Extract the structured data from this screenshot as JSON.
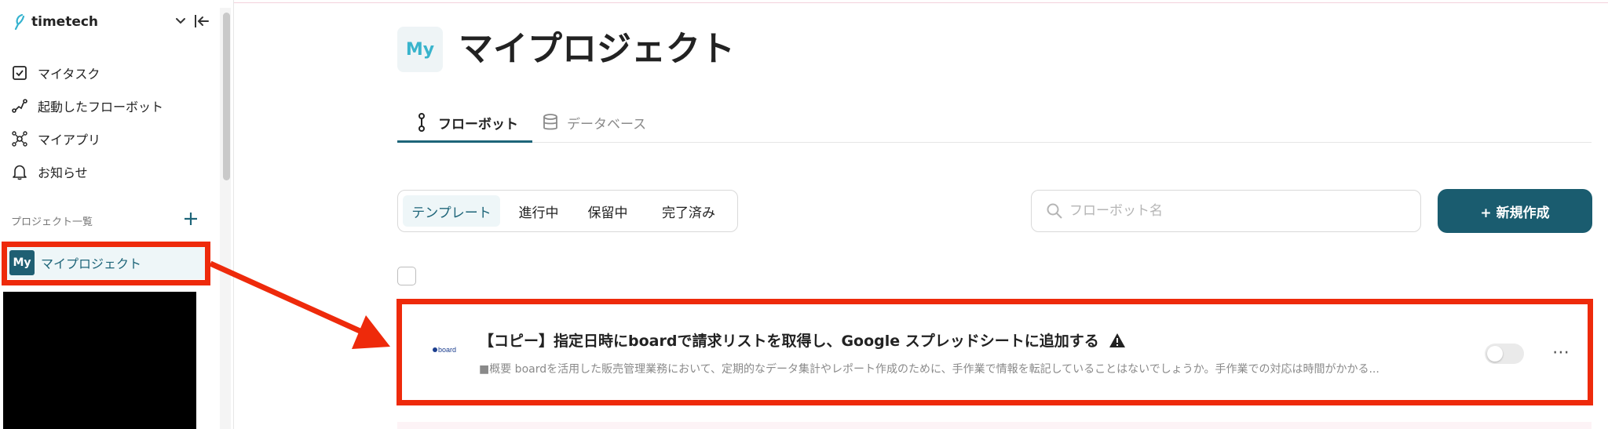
{
  "brand": {
    "name": "timetech"
  },
  "sidebar": {
    "nav": [
      {
        "label": "マイタスク",
        "icon": "task-check-icon"
      },
      {
        "label": "起動したフローボット",
        "icon": "flow-path-icon"
      },
      {
        "label": "マイアプリ",
        "icon": "app-network-icon"
      },
      {
        "label": "お知らせ",
        "icon": "bell-icon"
      }
    ],
    "section_label": "プロジェクト一覧",
    "project": {
      "avatar": "My",
      "label": "マイプロジェクト"
    }
  },
  "page": {
    "avatar": "My",
    "title": "マイプロジェクト",
    "tabs": [
      {
        "label": "フローボット",
        "active": true
      },
      {
        "label": "データベース",
        "active": false
      }
    ]
  },
  "filters": [
    {
      "label": "テンプレート",
      "active": true
    },
    {
      "label": "進行中",
      "active": false
    },
    {
      "label": "保留中",
      "active": false
    },
    {
      "label": "完了済み",
      "active": false
    }
  ],
  "search": {
    "placeholder": "フローボット名"
  },
  "new_button": {
    "label": "+ 新規作成"
  },
  "card": {
    "logo_text": "board",
    "title": "【コピー】指定日時にboardで請求リストを取得し、Google スプレッドシートに追加する",
    "description": "■概要 boardを活用した販売管理業務において、定期的なデータ集計やレポート作成のために、手作業で情報を転記していることはないでしょうか。手作業での対応は時間がかかる...",
    "enabled": false,
    "more_label": "⋯"
  },
  "colors": {
    "accent": "#1a5c6f",
    "annotation": "#ee2a0b",
    "active_bg": "#eef6f8"
  }
}
